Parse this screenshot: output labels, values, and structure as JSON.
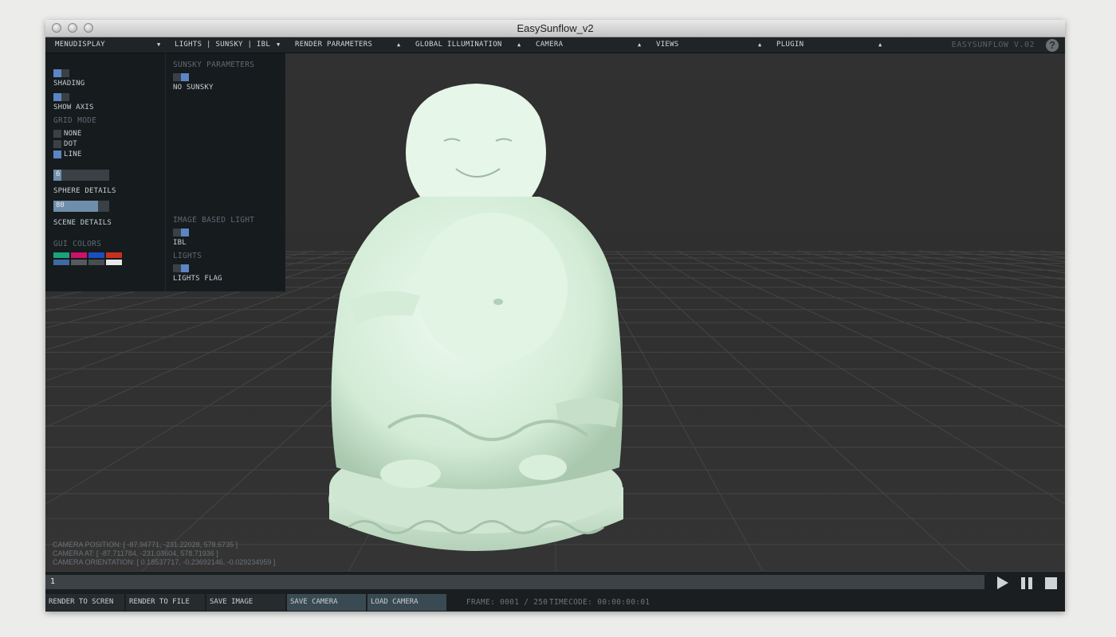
{
  "window": {
    "title": "EasySunflow_v2"
  },
  "menubar": {
    "menus": [
      {
        "label": "MENUDISPLAY",
        "arrow": "▼"
      },
      {
        "label": "LIGHTS | SUNSKY | IBL",
        "arrow": "▼"
      },
      {
        "label": "RENDER PARAMETERS",
        "arrow": "▲"
      },
      {
        "label": "GLOBAL ILLUMINATION",
        "arrow": "▲"
      },
      {
        "label": "CAMERA",
        "arrow": "▲"
      },
      {
        "label": "VIEWS",
        "arrow": "▲"
      },
      {
        "label": "PLUGIN",
        "arrow": "▲"
      }
    ],
    "version": "EASYSUNFLOW V.02",
    "help": "?"
  },
  "panel": {
    "shading": {
      "label": "SHADING",
      "on": false
    },
    "show_axis": {
      "label": "SHOW AXIS",
      "on": false
    },
    "grid_mode": {
      "header": "GRID MODE",
      "options": [
        {
          "label": "NONE",
          "checked": false
        },
        {
          "label": "DOT",
          "checked": false
        },
        {
          "label": "LINE",
          "checked": true
        }
      ]
    },
    "sphere_details": {
      "label": "SPHERE DETAILS",
      "value": "6",
      "fraction": 0.14
    },
    "scene_details": {
      "label": "SCENE DETAILS",
      "value": "80",
      "fraction": 0.8
    },
    "gui_colors": {
      "header": "GUI COLORS",
      "swatches": [
        "#1aa37a",
        "#d0106b",
        "#1b4fc0",
        "#c8301f",
        "#3f6aa3",
        "#555a5e",
        "#484d50",
        "#e8e8e8"
      ]
    },
    "sunsky": {
      "header": "SUNSKY PARAMETERS",
      "label": "NO SUNSKY",
      "on": true
    },
    "ibl": {
      "header": "IMAGE BASED LIGHT",
      "label": "IBL",
      "on": true
    },
    "lights": {
      "header": "LIGHTS",
      "label": "LIGHTS FLAG",
      "on": true
    }
  },
  "camera_info": {
    "position": "CAMERA POSITION: [ -87.94771, -231.22028, 578.6735 ]",
    "at": "CAMERA AT: [ -87.711784, -231.03604, 578.71936 ]",
    "orientation": "CAMERA ORIENTATION: [ 0.18537717, -0.23692146, -0.029234959 ]"
  },
  "timeline": {
    "value": "1"
  },
  "bottom": {
    "buttons": [
      {
        "label": "RENDER TO SCREN"
      },
      {
        "label": "RENDER TO FILE"
      },
      {
        "label": "SAVE IMAGE"
      },
      {
        "label": "SAVE CAMERA"
      },
      {
        "label": "LOAD CAMERA"
      }
    ],
    "frame": "FRAME: 0001 / 250",
    "timecode": "TIMECODE: 00:00:00:01"
  },
  "colors": {
    "accent": "#5b85c4",
    "model": "#d8f0dc"
  }
}
